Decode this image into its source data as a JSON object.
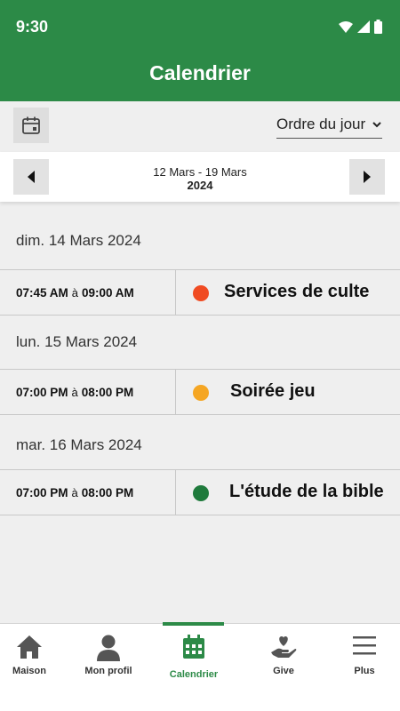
{
  "status": {
    "time": "9:30"
  },
  "header": {
    "title": "Calendrier"
  },
  "toolbar": {
    "order_label": "Ordre du jour"
  },
  "week": {
    "range": "12 Mars - 19 Mars",
    "year": "2024"
  },
  "days": [
    {
      "date": "dim. 14 Mars 2024",
      "event": {
        "start": "07:45 AM",
        "sep": "à",
        "end": "09:00 AM",
        "title": "Services de culte",
        "color": "#f04b22"
      }
    },
    {
      "date": "lun. 15 Mars 2024",
      "event": {
        "start": "07:00 PM",
        "sep": "à",
        "end": "08:00 PM",
        "title": "Soirée jeu",
        "color": "#f5a623"
      }
    },
    {
      "date": "mar. 16 Mars 2024",
      "event": {
        "start": "07:00 PM",
        "sep": "à",
        "end": "08:00 PM",
        "title": "L'étude de la bible",
        "color": "#1f7a3c"
      }
    }
  ],
  "bottom_nav": [
    {
      "label": "Maison",
      "icon": "home-icon"
    },
    {
      "label": "Mon profil",
      "icon": "person-icon"
    },
    {
      "label": "Calendrier",
      "icon": "calendar-icon",
      "active": true
    },
    {
      "label": "Give",
      "icon": "give-icon"
    },
    {
      "label": "Plus",
      "icon": "menu-icon"
    }
  ],
  "colors": {
    "brand": "#2c8a47"
  }
}
